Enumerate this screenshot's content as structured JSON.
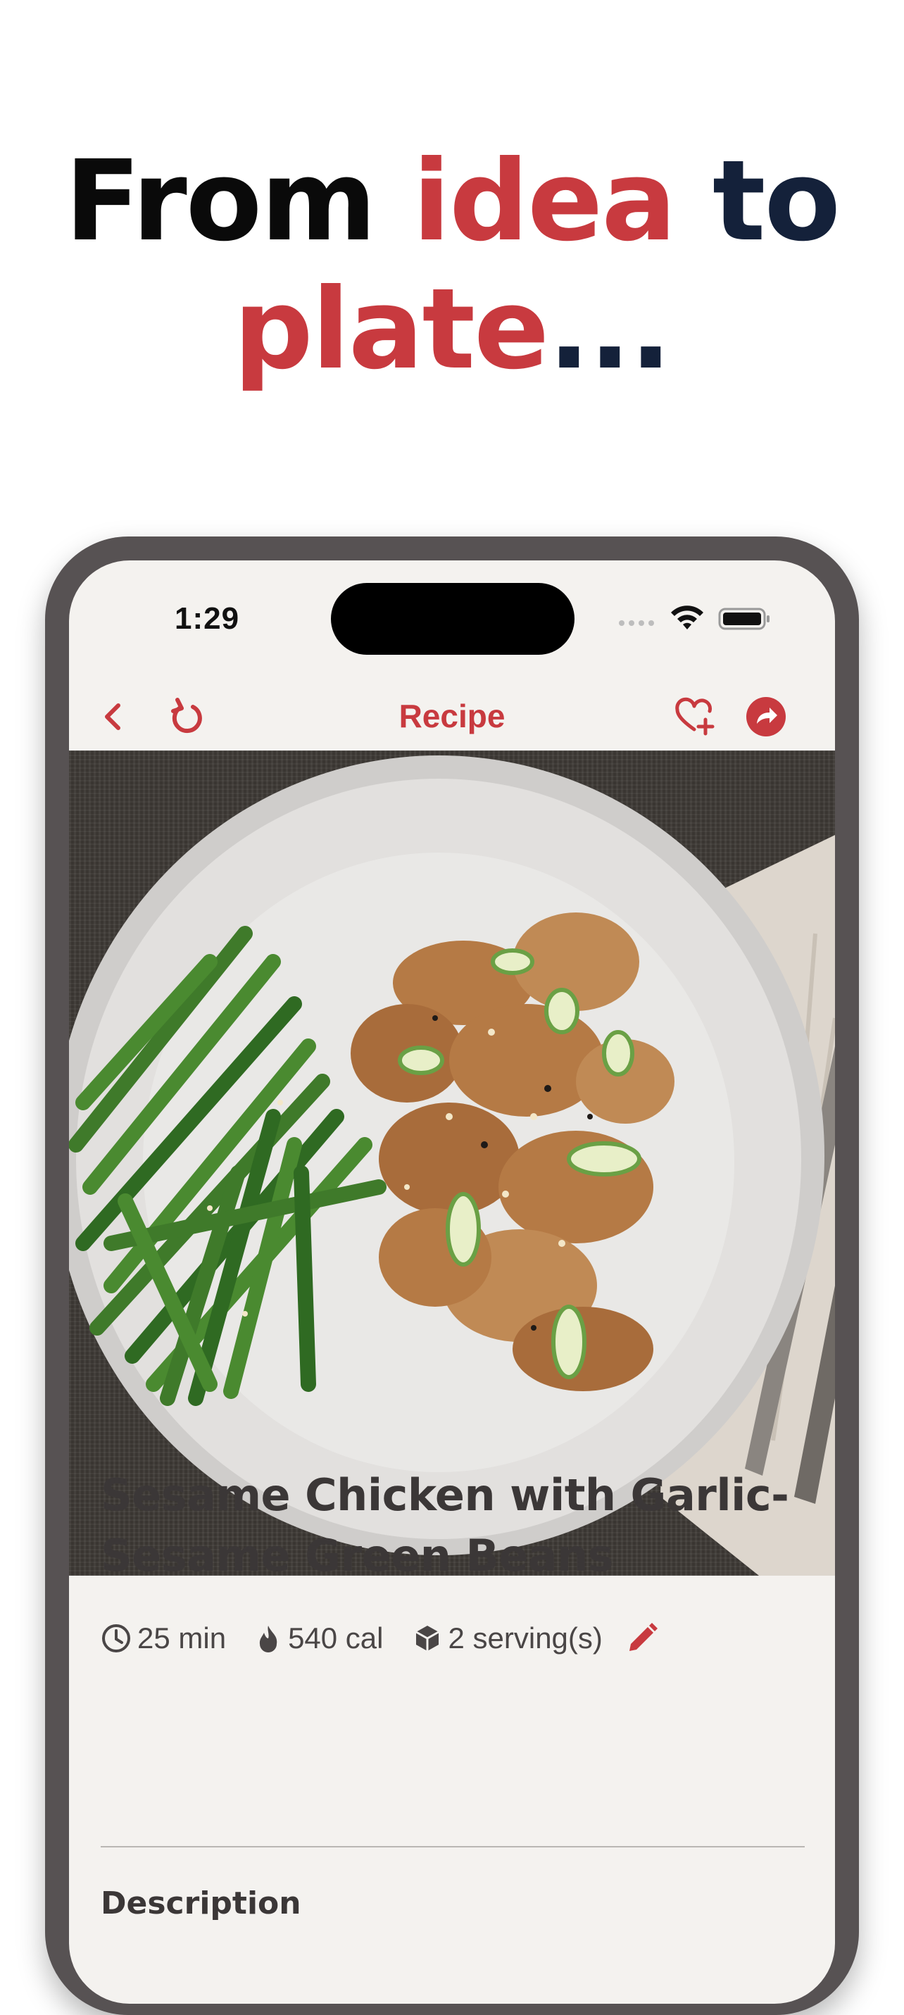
{
  "headline": {
    "line1_part1": "From ",
    "line1_part2": "idea",
    "line1_part3": " to",
    "line2_part1": "plate",
    "line2_part2": "..."
  },
  "status_bar": {
    "time": "1:29"
  },
  "nav": {
    "title": "Recipe"
  },
  "recipe": {
    "title": "Sesame Chicken with Garlic-Sesame Green Beans",
    "time": "25 min",
    "calories": "540 cal",
    "servings": "2 serving(s)",
    "section_heading": "Description"
  },
  "colors": {
    "accent": "#c83a3f",
    "navy": "#14213a",
    "frame": "#575253",
    "screen_bg": "#f4f2ef"
  },
  "icons": [
    "back-icon",
    "refresh-icon",
    "heart-plus-icon",
    "share-icon",
    "clock-icon",
    "flame-icon",
    "cube-icon",
    "edit-pencil-icon"
  ]
}
